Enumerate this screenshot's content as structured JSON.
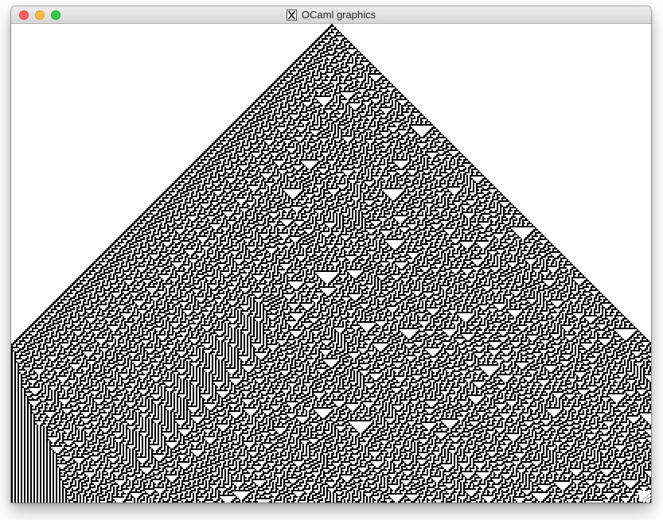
{
  "window": {
    "title": "OCaml graphics",
    "title_icon": "x11-icon"
  },
  "controls": {
    "close": "close-button",
    "minimize": "minimize-button",
    "zoom": "zoom-button"
  },
  "colors": {
    "close": "#fc605b",
    "minimize": "#fdbc40",
    "zoom": "#34c84a",
    "cell_on": "#000000",
    "cell_off": "#ffffff"
  }
}
